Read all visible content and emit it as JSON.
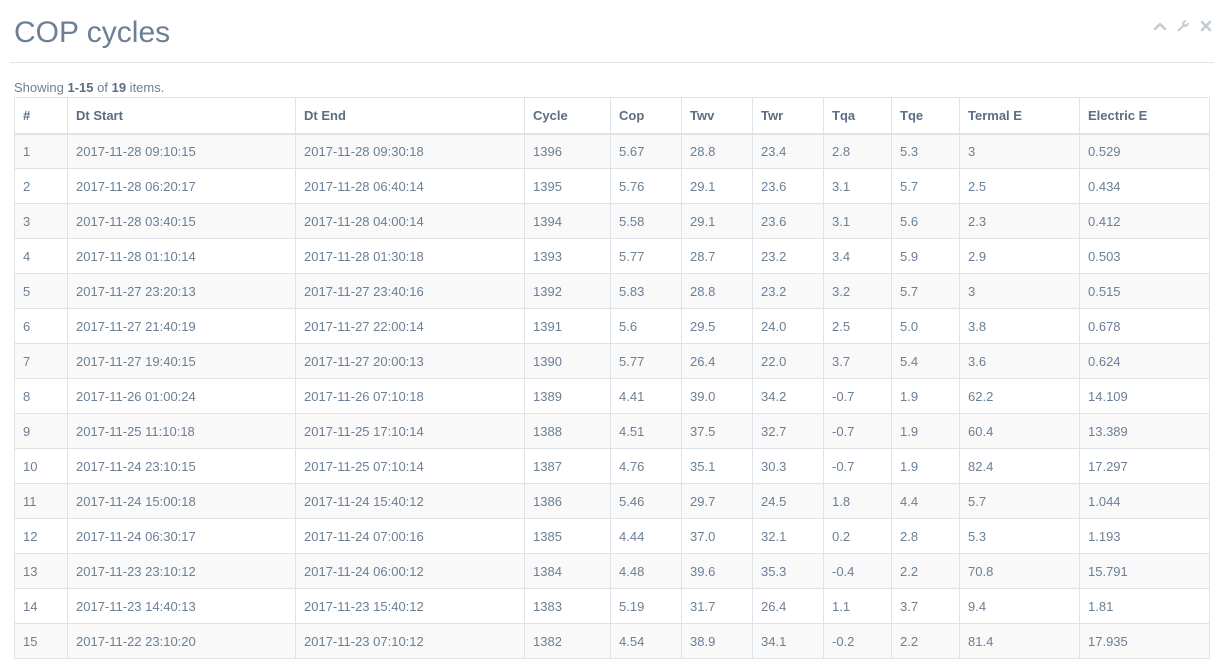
{
  "widget": {
    "title": "COP cycles",
    "tools": [
      "collapse-icon",
      "wrench-icon",
      "close-icon"
    ]
  },
  "summary": {
    "prefix": "Showing ",
    "range": "1-15",
    "middle": " of ",
    "total": "19",
    "suffix": " items."
  },
  "table": {
    "columns": [
      "#",
      "Dt Start",
      "Dt End",
      "Cycle",
      "Cop",
      "Twv",
      "Twr",
      "Tqa",
      "Tqe",
      "Termal E",
      "Electric E"
    ],
    "rows": [
      [
        "1",
        "2017-11-28 09:10:15",
        "2017-11-28 09:30:18",
        "1396",
        "5.67",
        "28.8",
        "23.4",
        "2.8",
        "5.3",
        "3",
        "0.529"
      ],
      [
        "2",
        "2017-11-28 06:20:17",
        "2017-11-28 06:40:14",
        "1395",
        "5.76",
        "29.1",
        "23.6",
        "3.1",
        "5.7",
        "2.5",
        "0.434"
      ],
      [
        "3",
        "2017-11-28 03:40:15",
        "2017-11-28 04:00:14",
        "1394",
        "5.58",
        "29.1",
        "23.6",
        "3.1",
        "5.6",
        "2.3",
        "0.412"
      ],
      [
        "4",
        "2017-11-28 01:10:14",
        "2017-11-28 01:30:18",
        "1393",
        "5.77",
        "28.7",
        "23.2",
        "3.4",
        "5.9",
        "2.9",
        "0.503"
      ],
      [
        "5",
        "2017-11-27 23:20:13",
        "2017-11-27 23:40:16",
        "1392",
        "5.83",
        "28.8",
        "23.2",
        "3.2",
        "5.7",
        "3",
        "0.515"
      ],
      [
        "6",
        "2017-11-27 21:40:19",
        "2017-11-27 22:00:14",
        "1391",
        "5.6",
        "29.5",
        "24.0",
        "2.5",
        "5.0",
        "3.8",
        "0.678"
      ],
      [
        "7",
        "2017-11-27 19:40:15",
        "2017-11-27 20:00:13",
        "1390",
        "5.77",
        "26.4",
        "22.0",
        "3.7",
        "5.4",
        "3.6",
        "0.624"
      ],
      [
        "8",
        "2017-11-26 01:00:24",
        "2017-11-26 07:10:18",
        "1389",
        "4.41",
        "39.0",
        "34.2",
        "-0.7",
        "1.9",
        "62.2",
        "14.109"
      ],
      [
        "9",
        "2017-11-25 11:10:18",
        "2017-11-25 17:10:14",
        "1388",
        "4.51",
        "37.5",
        "32.7",
        "-0.7",
        "1.9",
        "60.4",
        "13.389"
      ],
      [
        "10",
        "2017-11-24 23:10:15",
        "2017-11-25 07:10:14",
        "1387",
        "4.76",
        "35.1",
        "30.3",
        "-0.7",
        "1.9",
        "82.4",
        "17.297"
      ],
      [
        "11",
        "2017-11-24 15:00:18",
        "2017-11-24 15:40:12",
        "1386",
        "5.46",
        "29.7",
        "24.5",
        "1.8",
        "4.4",
        "5.7",
        "1.044"
      ],
      [
        "12",
        "2017-11-24 06:30:17",
        "2017-11-24 07:00:16",
        "1385",
        "4.44",
        "37.0",
        "32.1",
        "0.2",
        "2.8",
        "5.3",
        "1.193"
      ],
      [
        "13",
        "2017-11-23 23:10:12",
        "2017-11-24 06:00:12",
        "1384",
        "4.48",
        "39.6",
        "35.3",
        "-0.4",
        "2.2",
        "70.8",
        "15.791"
      ],
      [
        "14",
        "2017-11-23 14:40:13",
        "2017-11-23 15:40:12",
        "1383",
        "5.19",
        "31.7",
        "26.4",
        "1.1",
        "3.7",
        "9.4",
        "1.81"
      ],
      [
        "15",
        "2017-11-22 23:10:20",
        "2017-11-23 07:10:12",
        "1382",
        "4.54",
        "38.9",
        "34.1",
        "-0.2",
        "2.2",
        "81.4",
        "17.935"
      ]
    ]
  },
  "colors": {
    "text": "#6b7f95",
    "header_text": "#5a6e84",
    "border": "#dfe2e6",
    "stripe": "#f9f9f9",
    "icon": "#c5cbd2"
  }
}
